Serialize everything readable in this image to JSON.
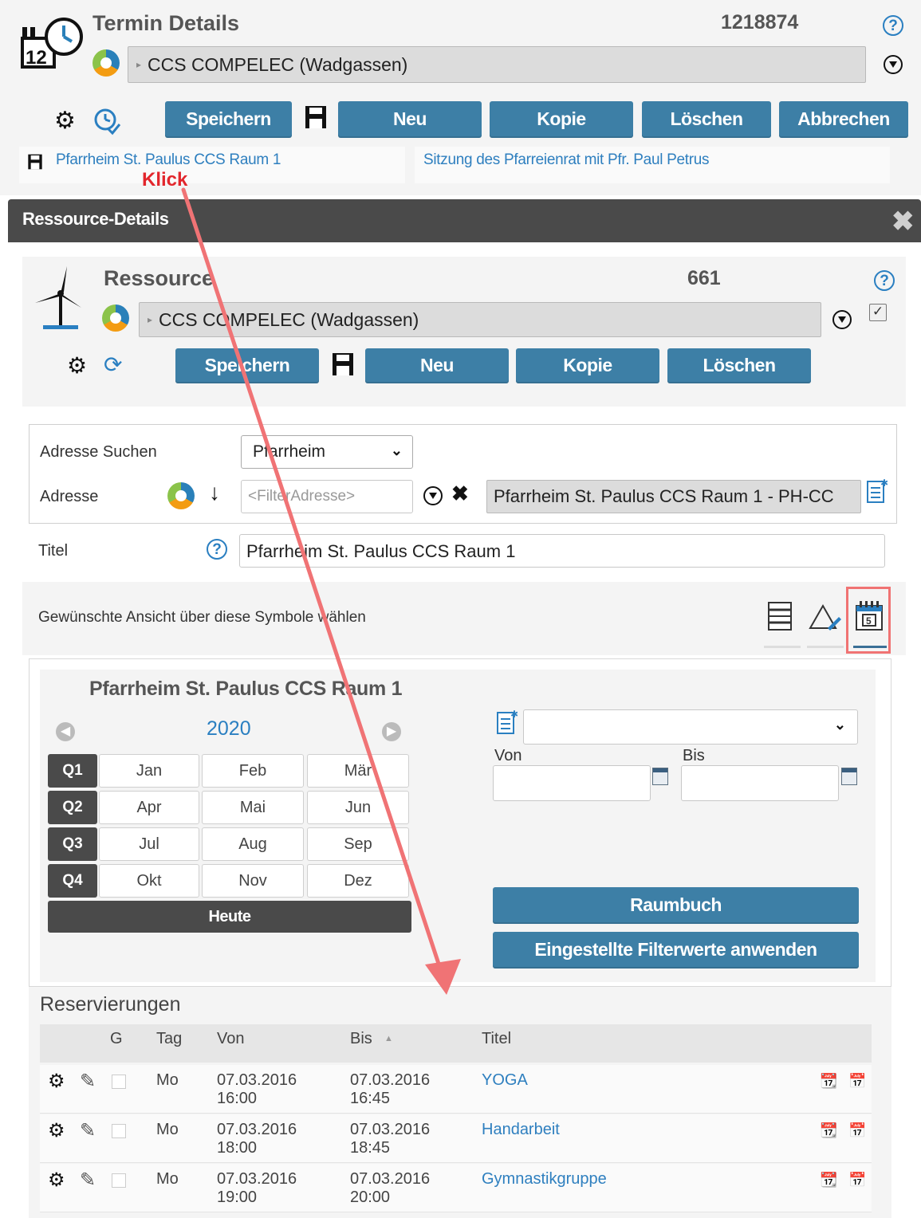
{
  "termin": {
    "title": "Termin Details",
    "number": "1218874",
    "org_value": "CCS COMPELEC (Wadgassen)",
    "buttons": {
      "save": "Speichern",
      "new": "Neu",
      "copy": "Kopie",
      "delete": "Löschen",
      "cancel": "Abbrechen"
    },
    "ressource_link": "Pfarrheim St. Paulus CCS Raum 1",
    "session_link": "Sitzung des Pfarreienrat mit Pfr. Paul Petrus"
  },
  "annotation": {
    "label": "Klick",
    "color": "#f0686a"
  },
  "dialog": {
    "title": "Ressource-Details",
    "header_color": "#4a4a4a",
    "ressource": {
      "title": "Ressource",
      "number": "661",
      "org_value": "CCS COMPELEC (Wadgassen)",
      "buttons": {
        "save": "Speichern",
        "new": "Neu",
        "copy": "Kopie",
        "delete": "Löschen"
      }
    },
    "address": {
      "search_label": "Adresse Suchen",
      "search_value": "Pfarrheim",
      "label": "Adresse",
      "filter_placeholder": "<FilterAdresse>",
      "value": "Pfarrheim St. Paulus CCS Raum 1 - PH-CC"
    },
    "titel": {
      "label": "Titel",
      "value": "Pfarrheim St. Paulus CCS Raum 1"
    },
    "view_hint": "Gewünschte Ansicht über diese Symbole wählen",
    "calendar": {
      "heading": "Pfarrheim St. Paulus CCS Raum 1",
      "year": "2020",
      "quarters": [
        {
          "q": "Q1",
          "months": [
            "Jan",
            "Feb",
            "Mär"
          ]
        },
        {
          "q": "Q2",
          "months": [
            "Apr",
            "Mai",
            "Jun"
          ]
        },
        {
          "q": "Q3",
          "months": [
            "Jul",
            "Aug",
            "Sep"
          ]
        },
        {
          "q": "Q4",
          "months": [
            "Okt",
            "Nov",
            "Dez"
          ]
        }
      ],
      "today": "Heute"
    },
    "filter": {
      "von": "Von",
      "bis": "Bis",
      "raumbuch": "Raumbuch",
      "apply": "Eingestellte Filterwerte anwenden"
    },
    "reservations": {
      "heading": "Reservierungen",
      "columns": {
        "g": "G",
        "tag": "Tag",
        "von": "Von",
        "bis": "Bis",
        "titel": "Titel"
      },
      "rows": [
        {
          "tag": "Mo",
          "von_date": "07.03.2016",
          "von_time": "16:00",
          "bis_date": "07.03.2016",
          "bis_time": "16:45",
          "titel": "YOGA"
        },
        {
          "tag": "Mo",
          "von_date": "07.03.2016",
          "von_time": "18:00",
          "bis_date": "07.03.2016",
          "bis_time": "18:45",
          "titel": "Handarbeit"
        },
        {
          "tag": "Mo",
          "von_date": "07.03.2016",
          "von_time": "19:00",
          "bis_date": "07.03.2016",
          "bis_time": "20:00",
          "titel": "Gymnastikgruppe"
        }
      ]
    }
  }
}
